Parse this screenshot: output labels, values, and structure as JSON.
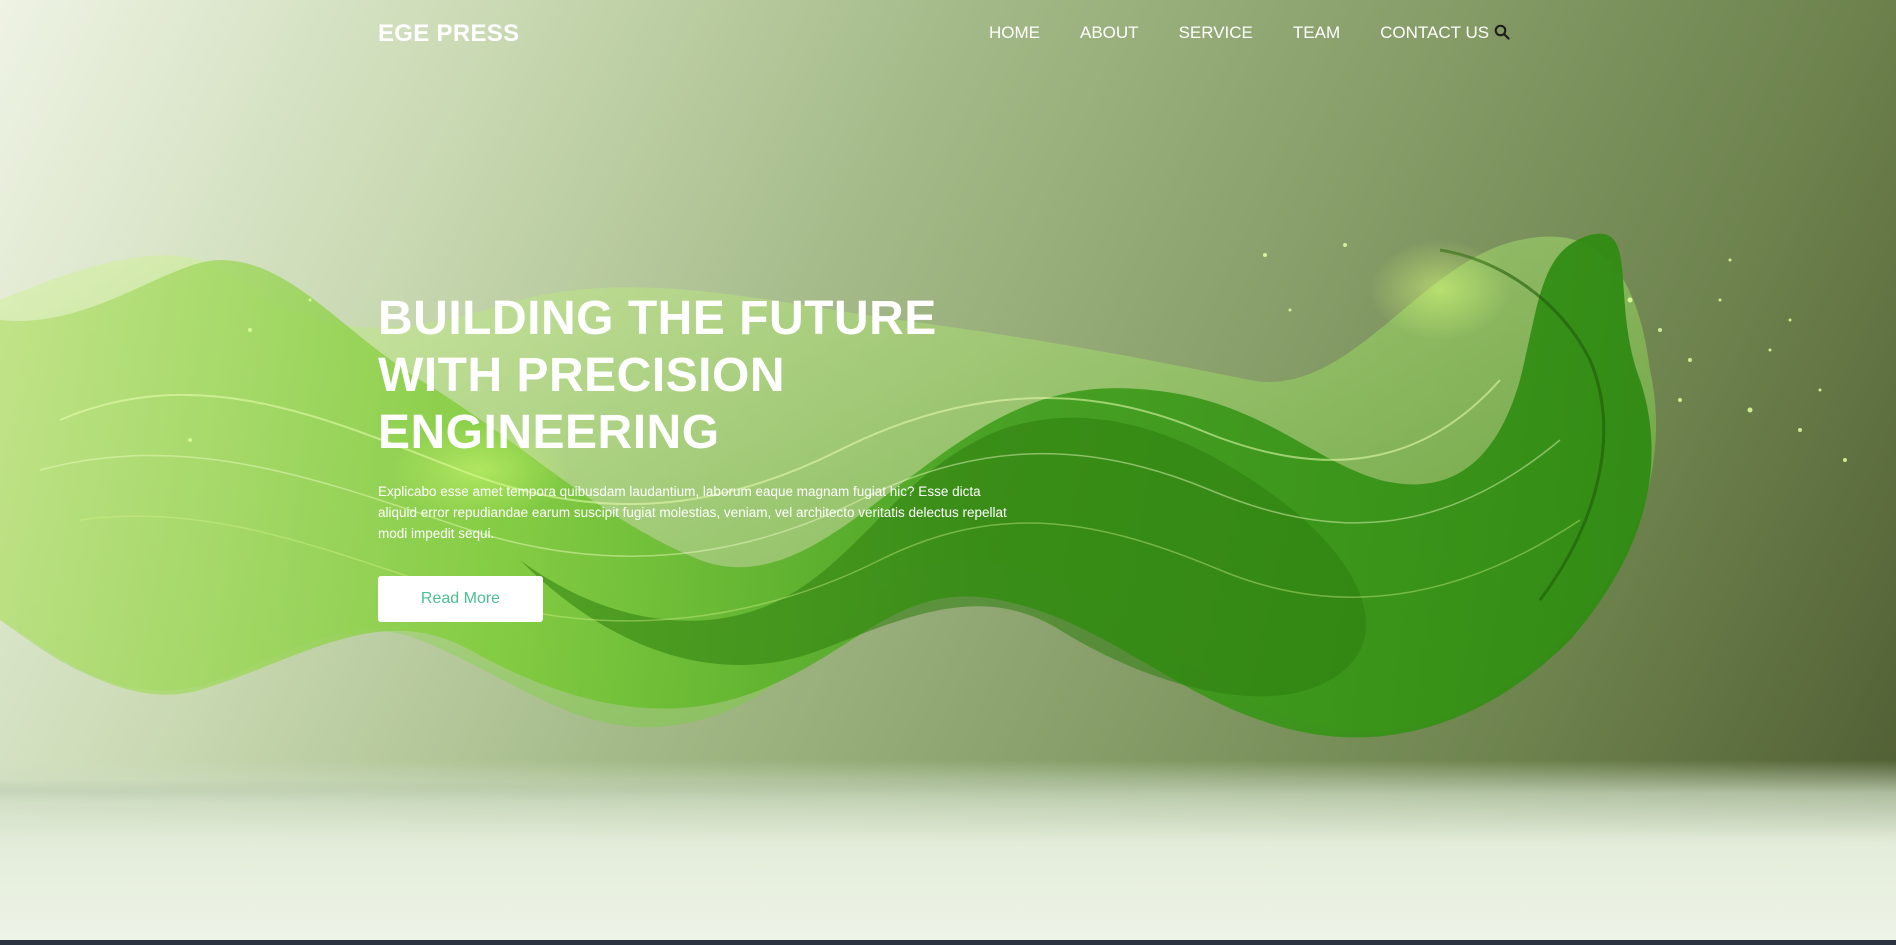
{
  "brand": {
    "name": "EGE PRESS"
  },
  "nav": {
    "items": [
      {
        "label": "HOME"
      },
      {
        "label": "ABOUT"
      },
      {
        "label": "SERVICE"
      },
      {
        "label": "TEAM"
      },
      {
        "label": "CONTACT US"
      }
    ],
    "search_icon": "search-icon"
  },
  "hero": {
    "headline_lines": [
      "BUILDING THE FUTURE",
      "WITH PRECISION",
      "ENGINEERING"
    ],
    "description": "Explicabo esse amet tempora quibusdam laudantium, laborum eaque magnam fugiat hic? Esse dicta aliquid error repudiandae earum suscipit fugiat molestias, veniam, vel architecto veritatis delectus repellat modi impedit sequi.",
    "cta_label": "Read More"
  },
  "colors": {
    "accent_button_text": "#4cbf93",
    "wave_green": "#5dbf2a",
    "background_dark": "#4d5a30",
    "background_light": "#eef3e4"
  }
}
